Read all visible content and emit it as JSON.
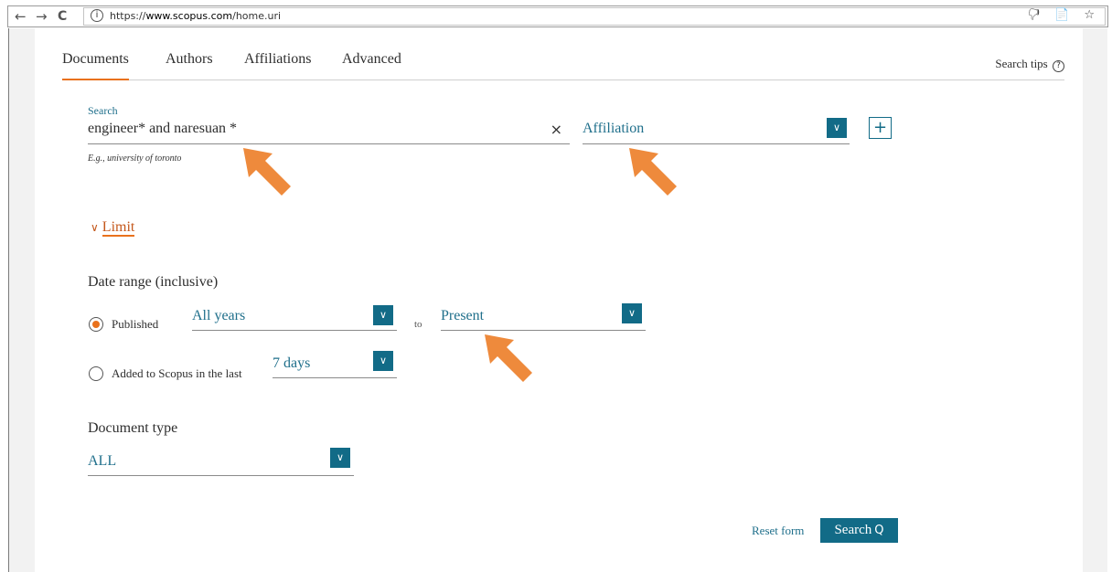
{
  "browser": {
    "back_icon": "←",
    "forward_icon": "→",
    "reload_icon": "C",
    "info_icon": "i",
    "url_scheme": "https://",
    "url_host": "www.scopus.com",
    "url_path": "/home.uri",
    "tool_icons": "🖓 📄 ☆"
  },
  "tabs": [
    {
      "label": "Documents"
    },
    {
      "label": "Authors"
    },
    {
      "label": "Affiliations"
    },
    {
      "label": "Advanced"
    }
  ],
  "search_tips": {
    "label": "Search tips",
    "icon": "?"
  },
  "search": {
    "label": "Search",
    "value": "engineer* and naresuan *",
    "clear_icon": "×",
    "example": "E.g., university of toronto",
    "field": "Affiliation",
    "add_icon": "+"
  },
  "limit": {
    "label": "Limit",
    "chevron": "∨"
  },
  "date_range": {
    "title": "Date range (inclusive)",
    "published_label": "Published",
    "from": "All years",
    "to_label": "to",
    "to": "Present",
    "added_label": "Added to Scopus in the last",
    "added_value": "7 days"
  },
  "document_type": {
    "title": "Document type",
    "value": "ALL"
  },
  "actions": {
    "reset": "Reset form",
    "search": "Search",
    "search_icon": "Q"
  },
  "dropdown_icon": "∨",
  "colors": {
    "accent": "#e9711c",
    "primary": "#126b87",
    "link": "#1f6f8b"
  }
}
